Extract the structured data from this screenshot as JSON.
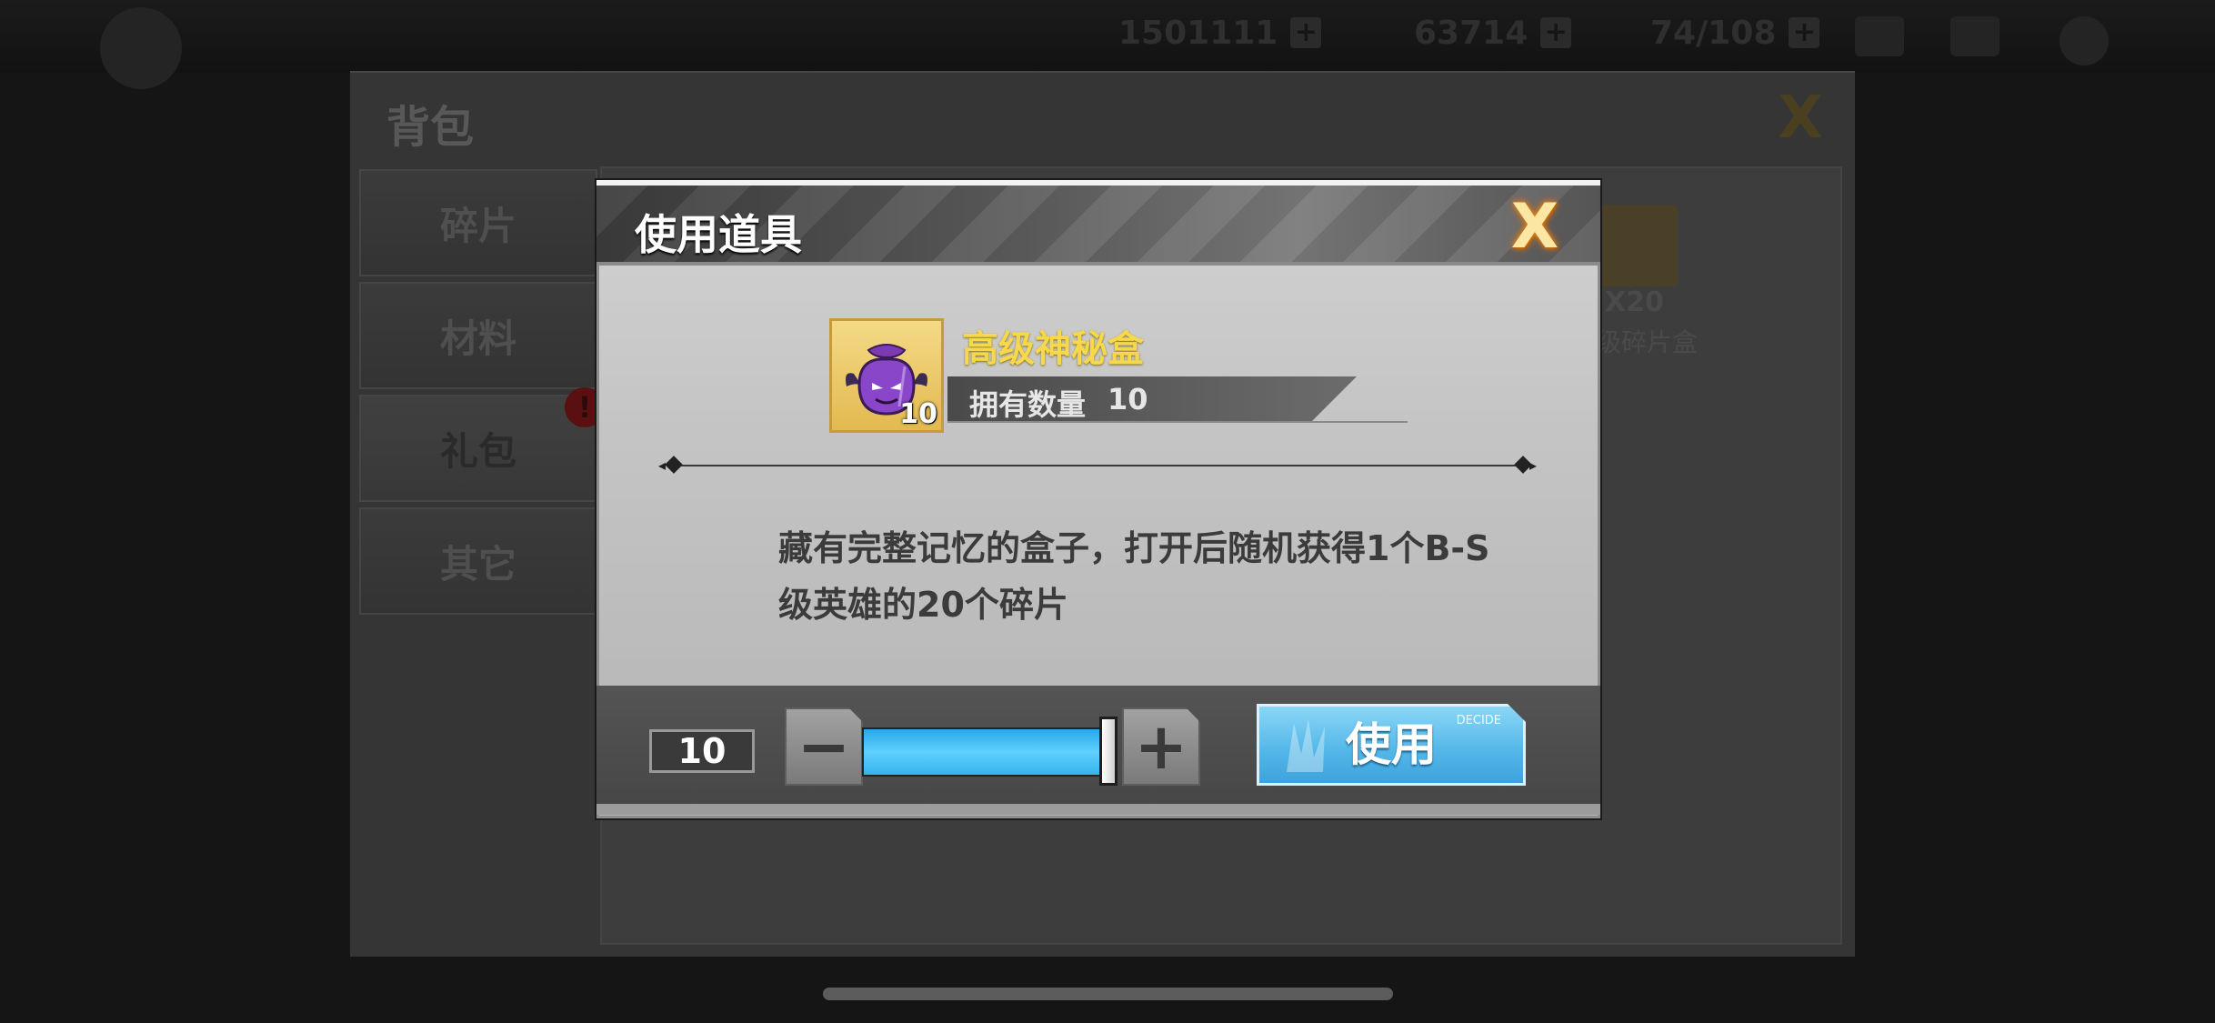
{
  "background": {
    "resources": [
      {
        "value": "1501111",
        "plus": "+"
      },
      {
        "value": "63714",
        "plus": "+"
      },
      {
        "value": "74/108",
        "plus": "+"
      }
    ],
    "bag": {
      "title": "背包",
      "close": "X",
      "tabs": [
        {
          "label": "碎片",
          "active": false
        },
        {
          "label": "材料",
          "active": false
        },
        {
          "label": "礼包",
          "active": true,
          "badge": "!"
        },
        {
          "label": "其它",
          "active": false
        }
      ],
      "item": {
        "count": "X20",
        "name": "级碎片盒"
      }
    }
  },
  "dialog": {
    "title": "使用道具",
    "close": "X",
    "item": {
      "icon": "purple-mystery-bag-icon",
      "count": "10",
      "name": "高级神秘盒",
      "owned_label": "拥有数量",
      "owned_value": "10"
    },
    "description": "藏有完整记忆的盒子，打开后随机获得1个B-S级英雄的20个碎片",
    "quantity": "10",
    "slider": {
      "fill_ratio": 1.0
    },
    "decrement_symbol": "−",
    "increment_symbol": "+",
    "use_button": {
      "label": "使用",
      "tag": "DECIDE"
    }
  },
  "colors": {
    "accent_blue": "#52b6e8",
    "item_name": "#f7d84a",
    "close_glow": "#e88b1a"
  }
}
